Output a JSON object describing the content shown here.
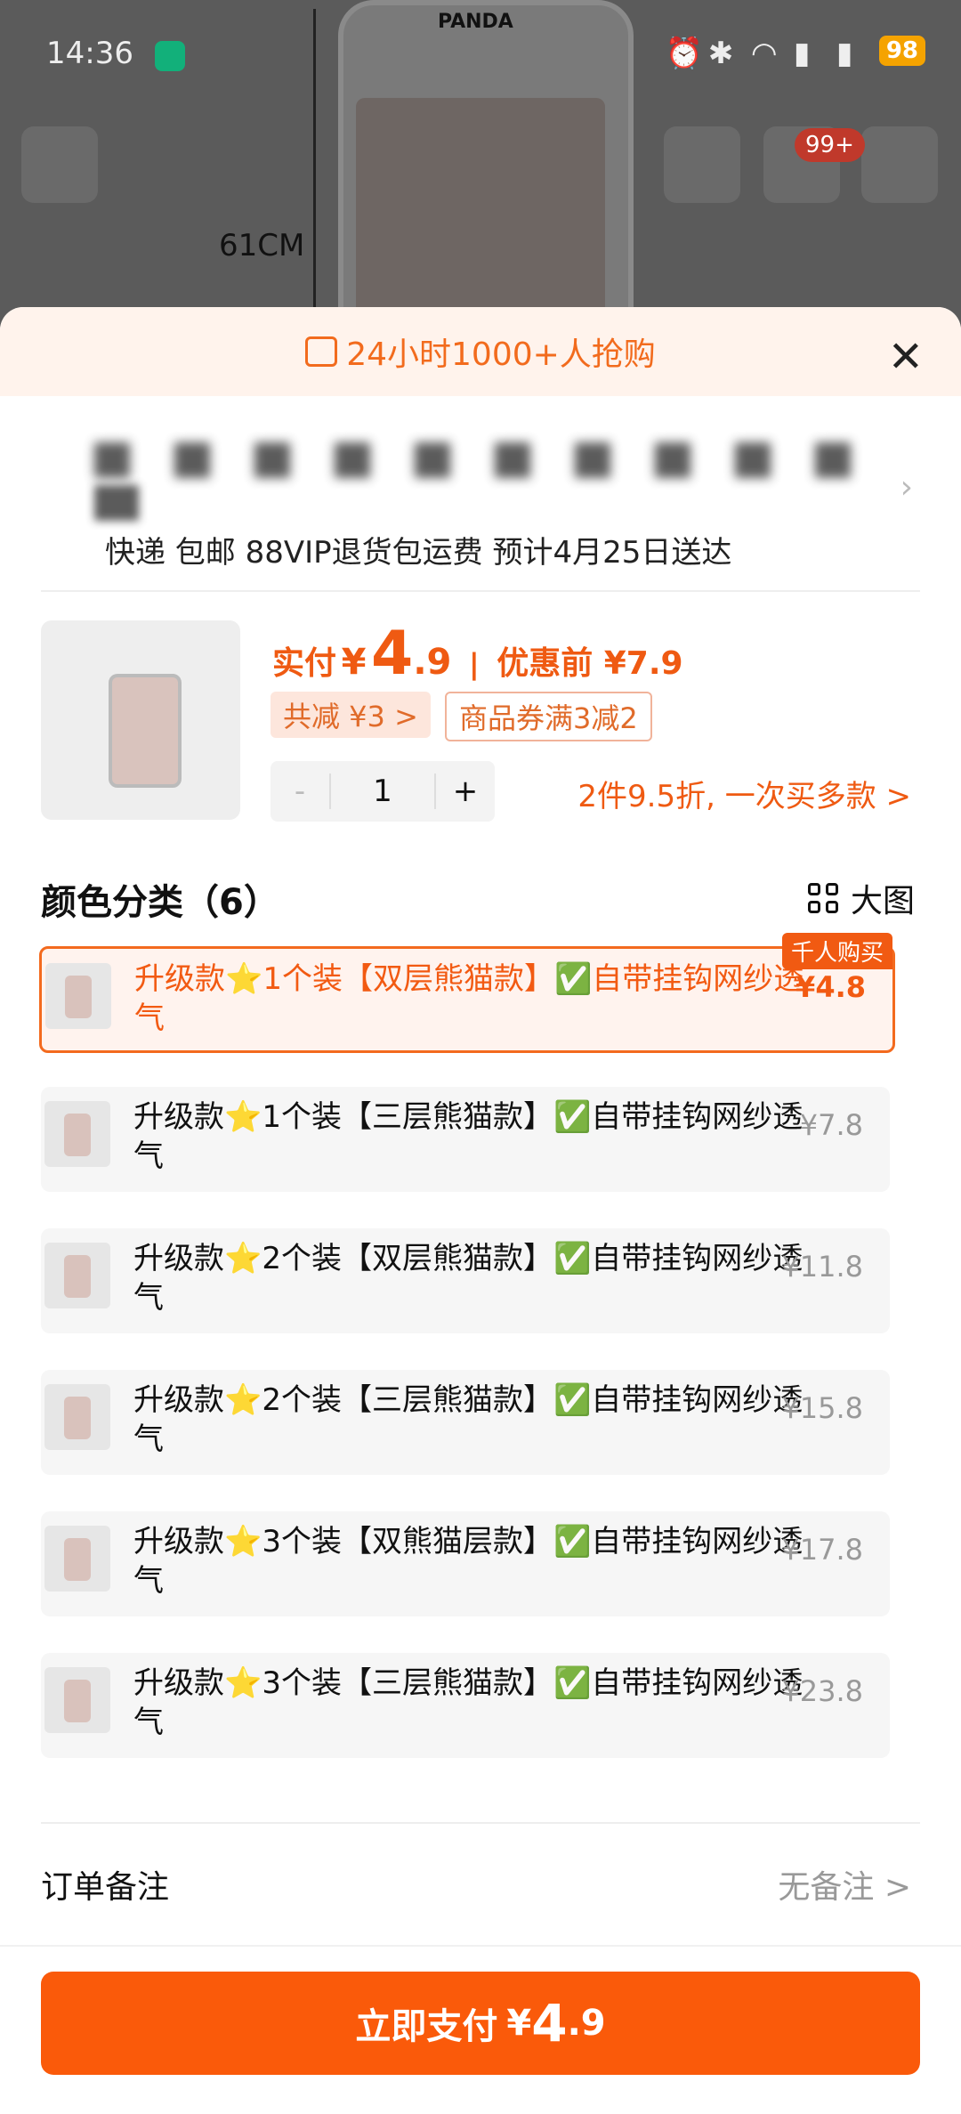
{
  "status_bar": {
    "time": "14:36",
    "battery": "98"
  },
  "background": {
    "dimension_label": "61CM",
    "brand_text": "PANDA"
  },
  "top_bar": {
    "cart_badge": "99+"
  },
  "sheet": {
    "banner_text": "24小时1000+人抢购",
    "shipping_info": "快递 包邮 88VIP退货包运费 预计4月25日送达",
    "price": {
      "pay_label": "实付",
      "currency": "¥",
      "amount_int": "4",
      "amount_dec": ".9",
      "before_label": "优惠前 ¥7.9"
    },
    "discount_chip": "共减 ¥3 >",
    "coupon_chip": "商品券满3减2",
    "quantity": "1",
    "qty_minus": "-",
    "qty_plus": "+",
    "bulk_offer": "2件9.5折, 一次买多款 >",
    "section_title": "颜色分类（6）",
    "big_image_label": "大图",
    "hot_tag": "千人购买",
    "options": [
      {
        "label": "升级款⭐1个装【双层熊猫款】✅自带挂钩网纱透气",
        "price": "¥4.8",
        "selected": true
      },
      {
        "label": "升级款⭐1个装【三层熊猫款】✅自带挂钩网纱透气",
        "price": "¥7.8",
        "selected": false
      },
      {
        "label": "升级款⭐2个装【双层熊猫款】✅自带挂钩网纱透气",
        "price": "¥11.8",
        "selected": false
      },
      {
        "label": "升级款⭐2个装【三层熊猫款】✅自带挂钩网纱透气",
        "price": "¥15.8",
        "selected": false
      },
      {
        "label": "升级款⭐3个装【双熊猫层款】✅自带挂钩网纱透气",
        "price": "¥17.8",
        "selected": false
      },
      {
        "label": "升级款⭐3个装【三层熊猫款】✅自带挂钩网纱透气",
        "price": "¥23.8",
        "selected": false
      }
    ],
    "remark_label": "订单备注",
    "remark_value": "无备注 >",
    "pay_button": {
      "text": "立即支付",
      "currency": "¥",
      "int": "4",
      "dec": ".9"
    }
  }
}
